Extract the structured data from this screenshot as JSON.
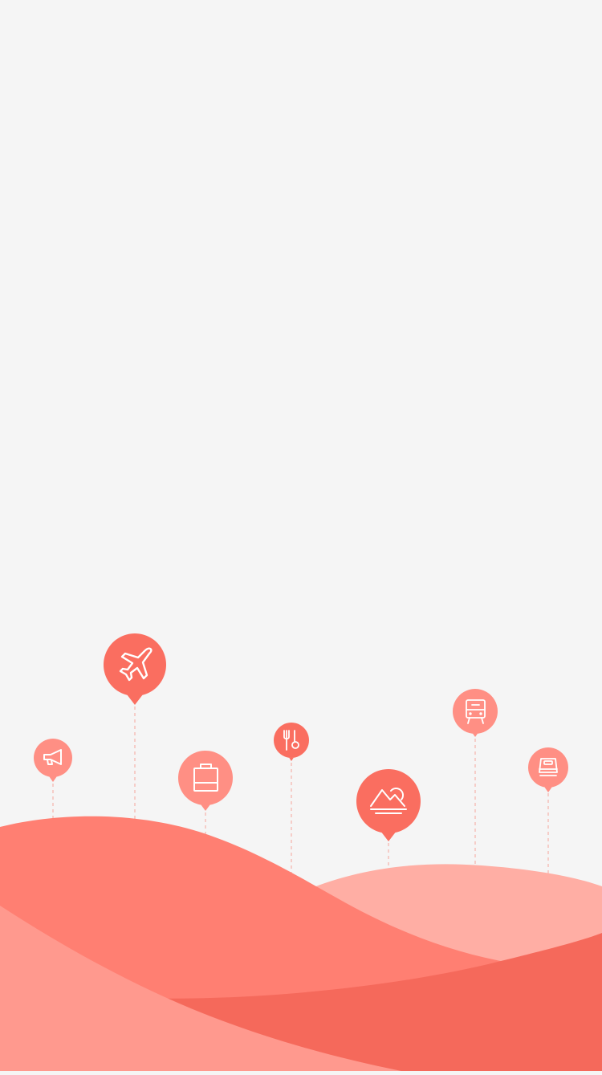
{
  "colors": {
    "background": "#f5f5f5",
    "hill_back": "#ffaea4",
    "hill_mid": "#ff7f72",
    "hill_dark": "#f5695b",
    "hill_front": "#ff998e",
    "pin_primary": "#fa6e60",
    "pin_secondary": "#ff8f84",
    "guide_line": "#f5a59c",
    "icon_stroke": "#ffffff"
  },
  "pins": [
    {
      "id": "megaphone",
      "icon": "megaphone-icon",
      "tone": "secondary"
    },
    {
      "id": "plane",
      "icon": "airplane-icon",
      "tone": "primary"
    },
    {
      "id": "bag",
      "icon": "shopping-bag-icon",
      "tone": "secondary"
    },
    {
      "id": "food",
      "icon": "fork-spoon-icon",
      "tone": "primary"
    },
    {
      "id": "scenery",
      "icon": "mountain-sun-icon",
      "tone": "primary"
    },
    {
      "id": "train",
      "icon": "train-icon",
      "tone": "secondary"
    },
    {
      "id": "hotel",
      "icon": "bed-icon",
      "tone": "secondary"
    }
  ]
}
